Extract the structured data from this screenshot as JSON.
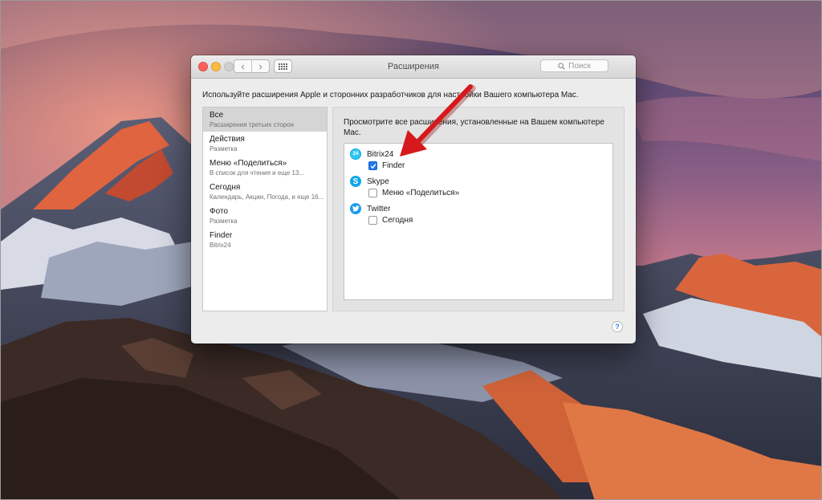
{
  "window": {
    "title": "Расширения",
    "search_placeholder": "Поиск",
    "description": "Используйте расширения Apple и сторонних разработчиков для настройки Вашего компьютера Mac."
  },
  "sidebar": {
    "items": [
      {
        "title": "Все",
        "subtitle": "Расширения третьих сторон",
        "selected": true
      },
      {
        "title": "Действия",
        "subtitle": "Разметка"
      },
      {
        "title": "Меню «Поделиться»",
        "subtitle": "В список для чтения и еще 13..."
      },
      {
        "title": "Сегодня",
        "subtitle": "Календарь, Акции, Погода, и еще 16..."
      },
      {
        "title": "Фото",
        "subtitle": "Разметка"
      },
      {
        "title": "Finder",
        "subtitle": "Bitrix24"
      }
    ]
  },
  "panel": {
    "description": "Просмотрите все расширения, установленные на Вашем компьютере Mac.",
    "groups": [
      {
        "name": "Bitrix24",
        "icon": "bitrix24-icon",
        "icon_text": "24",
        "items": [
          {
            "label": "Finder",
            "checked": true
          }
        ]
      },
      {
        "name": "Skype",
        "icon": "skype-icon",
        "icon_text": "S",
        "items": [
          {
            "label": "Меню «Поделиться»",
            "checked": false
          }
        ]
      },
      {
        "name": "Twitter",
        "icon": "twitter-icon",
        "items": [
          {
            "label": "Сегодня",
            "checked": false
          }
        ]
      }
    ]
  },
  "help": {
    "label": "?"
  },
  "colors": {
    "accent": "#1f79f2",
    "annotation_arrow": "#d6191c",
    "close": "#fc605b",
    "minimize": "#fdbc40"
  }
}
